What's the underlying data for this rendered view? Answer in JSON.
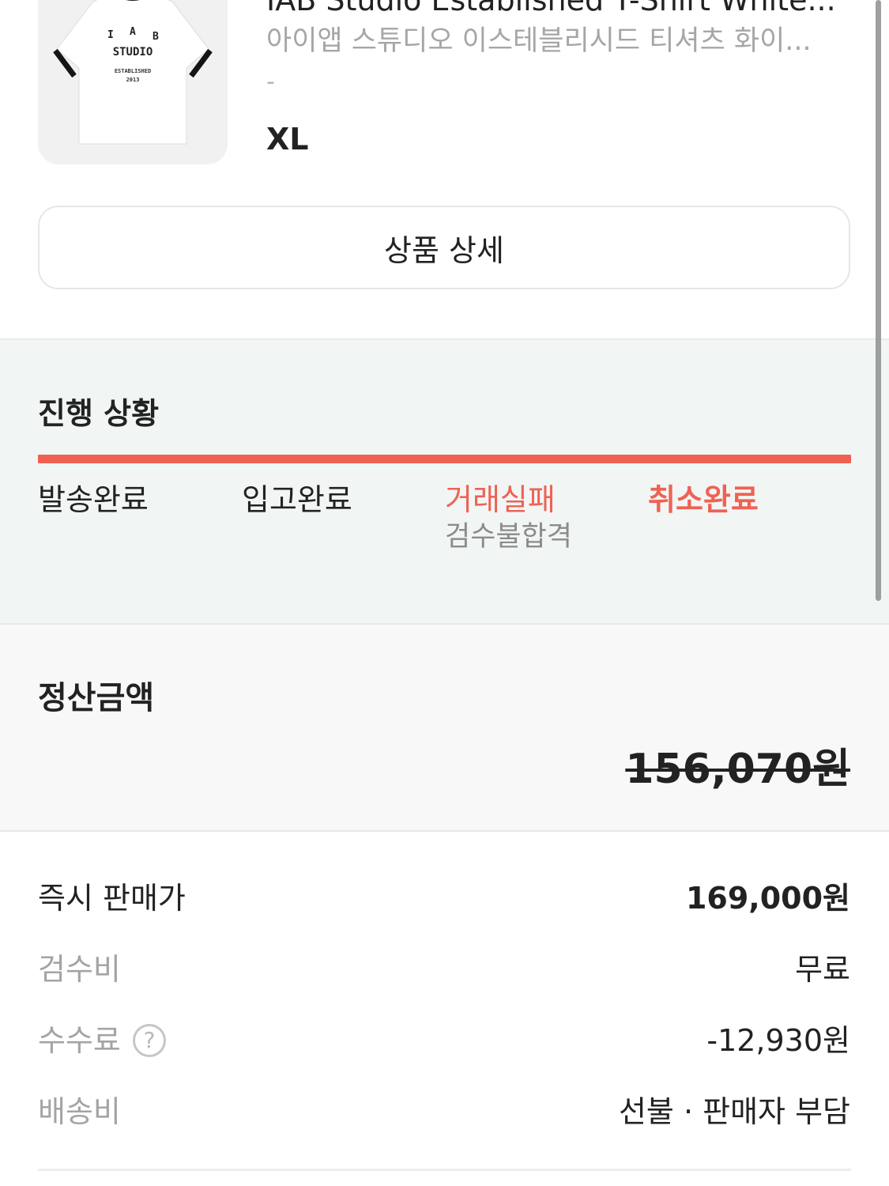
{
  "product": {
    "name": "IAB Studio Established T-Shirt White...",
    "name_ko": "아이앱 스튜디오 이스테블리시드 티셔츠 화이...",
    "option_dash": "-",
    "size": "XL",
    "detail_button_label": "상품 상세",
    "image_text": {
      "letters": "I A B",
      "brand": "STUDIO",
      "established": "ESTABLISHED",
      "year": "2013"
    }
  },
  "progress": {
    "title": "진행 상황",
    "fill_fraction": 1.0,
    "accent_color": "#ef6253",
    "steps": [
      {
        "label": "발송완료"
      },
      {
        "label": "입고완료"
      },
      {
        "label": "거래실패",
        "sublabel": "검수불합격"
      },
      {
        "label": "취소완료"
      }
    ]
  },
  "settlement": {
    "title": "정산금액",
    "amount": "156,070원"
  },
  "breakdown": {
    "instant_price": {
      "label": "즉시 판매가",
      "value": "169,000원"
    },
    "inspection_fee": {
      "label": "검수비",
      "value": "무료"
    },
    "commission": {
      "label": "수수료",
      "help_icon": "?",
      "value": "-12,930원"
    },
    "shipping": {
      "label": "배송비",
      "value": "선불 · 판매자 부담"
    }
  }
}
